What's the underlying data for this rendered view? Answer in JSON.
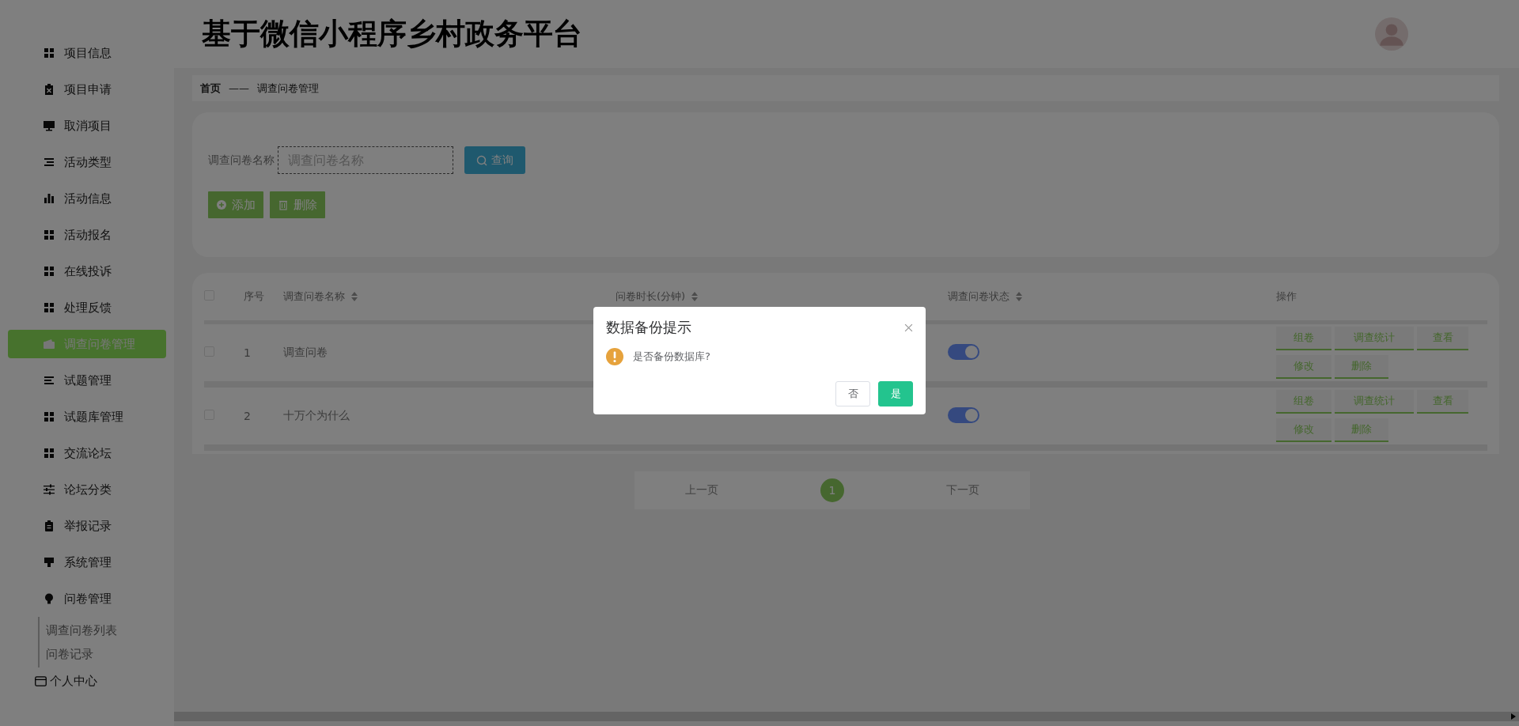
{
  "sidebar": {
    "items": [
      {
        "label": "项目信息",
        "selected": false
      },
      {
        "label": "项目申请",
        "selected": false
      },
      {
        "label": "取消项目",
        "selected": false
      },
      {
        "label": "活动类型",
        "selected": false
      },
      {
        "label": "活动信息",
        "selected": false
      },
      {
        "label": "活动报名",
        "selected": false
      },
      {
        "label": "在线投诉",
        "selected": false
      },
      {
        "label": "处理反馈",
        "selected": false
      },
      {
        "label": "调查问卷管理",
        "selected": true
      },
      {
        "label": "试题管理",
        "selected": false
      },
      {
        "label": "试题库管理",
        "selected": false
      },
      {
        "label": "交流论坛",
        "selected": false
      },
      {
        "label": "论坛分类",
        "selected": false
      },
      {
        "label": "举报记录",
        "selected": false
      },
      {
        "label": "系统管理",
        "selected": false
      },
      {
        "label": "问卷管理",
        "selected": false,
        "children": [
          {
            "label": "调查问卷列表",
            "selected": false
          },
          {
            "label": "问卷记录",
            "selected": false
          }
        ]
      }
    ],
    "footer_item": "个人中心"
  },
  "header": {
    "title": "基于微信小程序乡村政务平台"
  },
  "breadcrumb": {
    "home": "首页",
    "separator": "——",
    "current": "调查问卷管理"
  },
  "search": {
    "label": "调查问卷名称",
    "placeholder": "调查问卷名称",
    "button": "查询"
  },
  "actions": [
    "添加",
    "删除"
  ],
  "table": {
    "all_checked": false,
    "columns": [
      {
        "label": "序号",
        "sortable": false
      },
      {
        "label": "调查问卷名称",
        "sortable": true
      },
      {
        "label": "问卷时长(分钟)",
        "sortable": true
      },
      {
        "label": "调查问卷状态",
        "sortable": true
      },
      {
        "label": "操作",
        "sortable": false
      }
    ],
    "rows": [
      {
        "checked": false,
        "index": "1",
        "name": "调查问卷",
        "on": true,
        "actions": [
          "组卷",
          "调查统计",
          "查看",
          "修改",
          "删除"
        ]
      },
      {
        "checked": false,
        "index": "2",
        "name": "十万个为什么",
        "on": true,
        "actions": [
          "组卷",
          "调查统计",
          "查看",
          "修改",
          "删除"
        ]
      }
    ]
  },
  "pagination": {
    "prev": "上一页",
    "pages": [
      {
        "label": "1",
        "selected": true
      }
    ],
    "next": "下一页"
  },
  "dialog": {
    "title": "数据备份提示",
    "message": "是否备份数据库?",
    "buttons": [
      {
        "label": "否",
        "kind": "default"
      },
      {
        "label": "是",
        "kind": "primary"
      }
    ]
  }
}
